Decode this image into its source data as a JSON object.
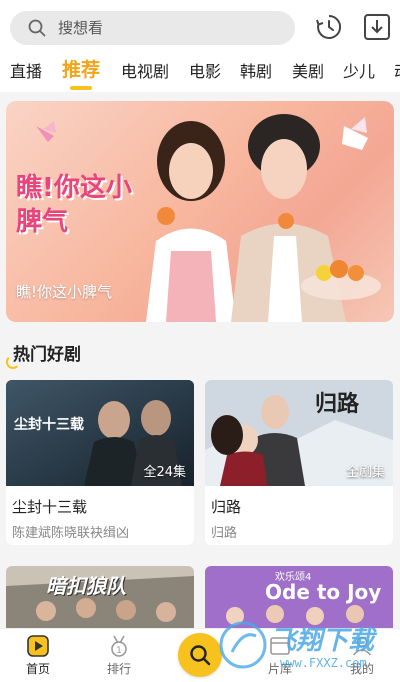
{
  "search": {
    "placeholder": "搜想看"
  },
  "tabs": [
    "直播",
    "推荐",
    "电视剧",
    "电影",
    "韩剧",
    "美剧",
    "少儿",
    "动"
  ],
  "active_tab": "推荐",
  "banner": {
    "logo_text": "瞧!你这小脾气",
    "caption": "瞧!你这小脾气"
  },
  "section": {
    "title": "热门好剧"
  },
  "cards": [
    {
      "title": "尘封十三载",
      "subtitle": "陈建斌陈晓联袂缉凶",
      "badge": "全24集",
      "thumb_text": "尘封十三载"
    },
    {
      "title": "归路",
      "subtitle": "归路",
      "badge": "全剧集",
      "thumb_text": "归路"
    },
    {
      "title": "",
      "subtitle": "",
      "badge": "",
      "thumb_text": "暗扣狼队"
    },
    {
      "title": "",
      "subtitle": "",
      "badge": "",
      "thumb_text": "Ode to Joy",
      "thumb_small": "欢乐颂4"
    }
  ],
  "bottom_nav": [
    {
      "label": "首页",
      "icon": "home-icon"
    },
    {
      "label": "排行",
      "icon": "rank-medal-icon"
    },
    {
      "label": "片库",
      "icon": "library-icon"
    },
    {
      "label": "我的",
      "icon": "profile-icon"
    }
  ],
  "watermark": {
    "text": "飞翔下载",
    "url": "www.FXXZ.com"
  },
  "colors": {
    "accent": "#f7c21e",
    "active_tab": "#f2a41a",
    "background": "#f4f4f4"
  }
}
